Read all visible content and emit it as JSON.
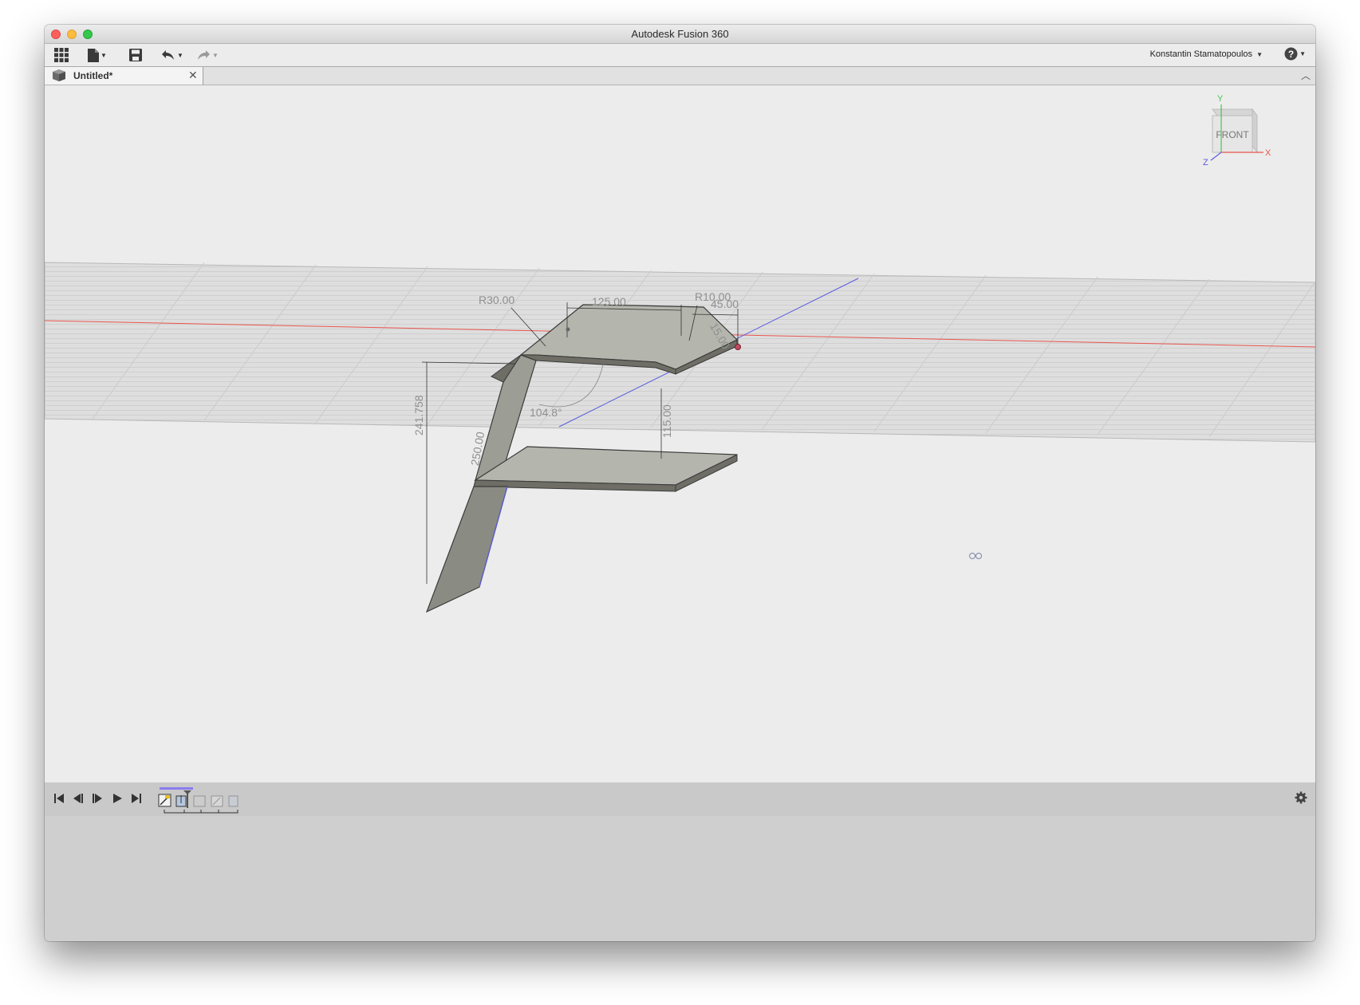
{
  "window": {
    "title": "Autodesk Fusion 360"
  },
  "toolbar": {
    "data_panel_icon": "grid-icon",
    "file_icon": "document-icon",
    "save_icon": "save-icon",
    "undo_icon": "undo-icon",
    "redo_icon": "redo-icon",
    "user_name": "Konstantin Stamatopoulos",
    "help_icon": "help-icon"
  },
  "tabs": [
    {
      "label": "Untitled*",
      "icon": "box-icon"
    }
  ],
  "viewcube": {
    "face": "FRONT",
    "axes": {
      "x": "X",
      "y": "Y",
      "z": "Z"
    }
  },
  "sketch": {
    "dimensions": {
      "r30": "R30.00",
      "d125": "125.00",
      "r10": "R10.00",
      "d45": "45.00",
      "d15": "15.00",
      "height": "241.758",
      "angle": "104.8°",
      "d115": "115.00",
      "d250": "250.00"
    }
  },
  "timeline": {
    "controls": [
      "skip-start",
      "step-back",
      "play-back",
      "play",
      "skip-end"
    ],
    "features": [
      "sketch-feature",
      "extrude-feature",
      "sheet-feature",
      "sketch-feature",
      "extrude-feature"
    ]
  },
  "colors": {
    "x_axis": "#e8554e",
    "z_axis": "#5a5ae0",
    "y_axis": "#4cc24c",
    "body_dark": "#6e6e66",
    "body_face": "#b4b6ad",
    "sketch_plane": "#dedede"
  }
}
